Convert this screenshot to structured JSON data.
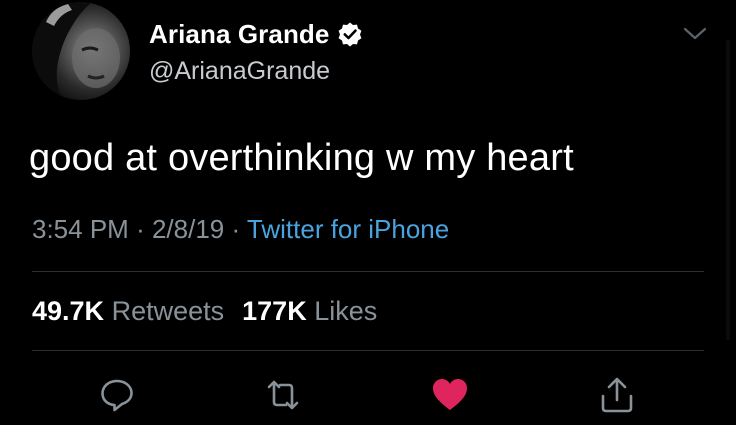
{
  "user": {
    "display_name": "Ariana Grande",
    "handle": "@ArianaGrande",
    "verified": true
  },
  "tweet": {
    "text": "good at overthinking w my heart",
    "time": "3:54 PM",
    "date": "2/8/19",
    "source": "Twitter for iPhone"
  },
  "stats": {
    "retweets_count": "49.7K",
    "retweets_label": "Retweets",
    "likes_count": "177K",
    "likes_label": "Likes"
  },
  "actions": {
    "reply_icon": "reply-icon",
    "retweet_icon": "retweet-icon",
    "like_icon": "heart-icon",
    "share_icon": "share-icon",
    "liked": true
  },
  "colors": {
    "background": "#000000",
    "link": "#4aa3df",
    "like": "#e0245e",
    "muted": "#8a9299"
  }
}
